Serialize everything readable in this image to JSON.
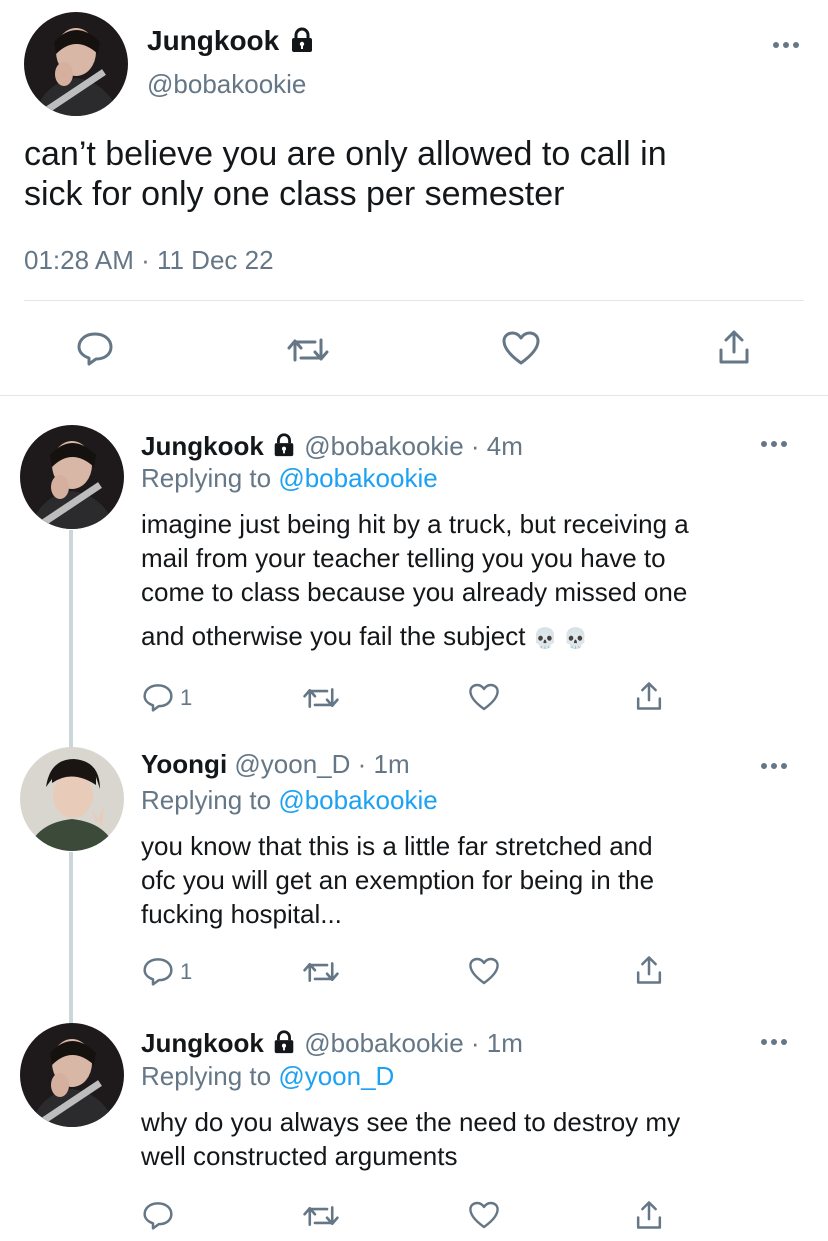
{
  "main_tweet": {
    "name": "Jungkook",
    "handle": "@bobakookie",
    "text_line1": "can’t believe you are only allowed to call in",
    "text_line2": "sick for only one class per semester",
    "timestamp": "01:28 AM · 11 Dec 22",
    "actions": [
      "reply-icon",
      "retweet-icon",
      "like-icon",
      "share-icon"
    ]
  },
  "replies": [
    {
      "name": "Jungkook",
      "handle": "@bobakookie",
      "time": "· 4m",
      "replying_label": "Replying to",
      "replying_to": "@bobakookie",
      "lines": [
        "imagine just being hit by a truck, but receiving a",
        "mail from your teacher telling you you have to",
        "come to class because you already missed one",
        "and otherwise you fail the subject"
      ],
      "emoji": "💀 💀",
      "reply_count": "1"
    },
    {
      "name": "Yoongi",
      "handle": "@yoon_D",
      "time": "· 1m",
      "replying_label": "Replying to",
      "replying_to": "@bobakookie",
      "lines": [
        "you know that this is a little far stretched and",
        "ofc you will get an exemption for being in the",
        "fucking hospital..."
      ],
      "reply_count": "1"
    },
    {
      "name": "Jungkook",
      "handle": "@bobakookie",
      "time": "· 1m",
      "replying_label": "Replying to",
      "replying_to": "@yoon_D",
      "lines": [
        "why do you always see the need to destroy my",
        "well constructed arguments"
      ],
      "reply_count": ""
    }
  ],
  "colors": {
    "text": "#14171a",
    "secondary": "#657786",
    "link": "#1da1f2",
    "thread_line": "#ccd6dd"
  }
}
